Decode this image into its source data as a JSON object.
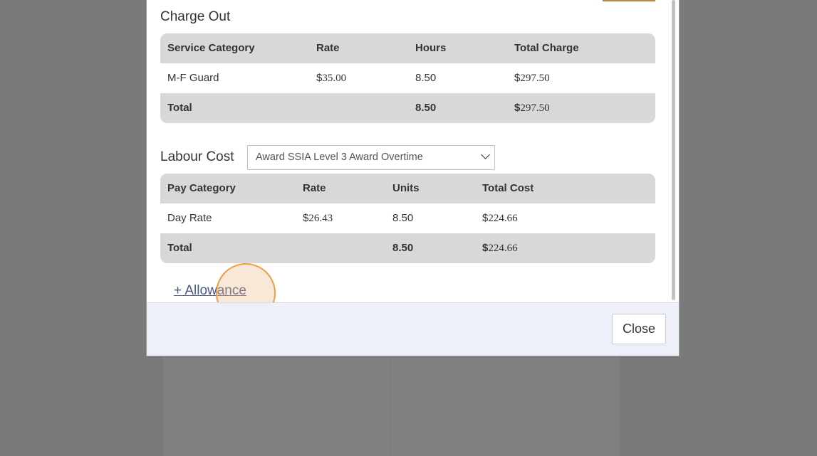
{
  "charge_out": {
    "title": "Charge Out",
    "headers": [
      "Service Category",
      "Rate",
      "Hours",
      "Total Charge"
    ],
    "rows": [
      {
        "category": "M-F Guard",
        "rate_sign": "$",
        "rate": "35.00",
        "hours": "8.50",
        "total_sign": "$",
        "total": "297.50"
      }
    ],
    "total": {
      "label": "Total",
      "hours": "8.50",
      "total_sign": "$",
      "total": "297.50"
    }
  },
  "labour_cost": {
    "title": "Labour Cost",
    "award_select": {
      "selected": "Award SSIA Level 3 Award Overtime"
    },
    "headers": [
      "Pay Category",
      "Rate",
      "Units",
      "Total Cost"
    ],
    "rows": [
      {
        "category": "Day Rate",
        "rate_sign": "$",
        "rate": "26.43",
        "units": "8.50",
        "total_sign": "$",
        "total": "224.66"
      }
    ],
    "total": {
      "label": "Total",
      "units": "8.50",
      "total_sign": "$",
      "total": "224.66"
    }
  },
  "allowance_link": "+ Allowance",
  "footer": {
    "close_label": "Close"
  },
  "colors": {
    "overlay": "#7a7a7a",
    "table_header": "#d8d8d8",
    "link": "#4a5a84",
    "footer_bg": "#edf0f8",
    "click_indicator": "#ef9c45",
    "gold_accent": "#b48a3c"
  }
}
